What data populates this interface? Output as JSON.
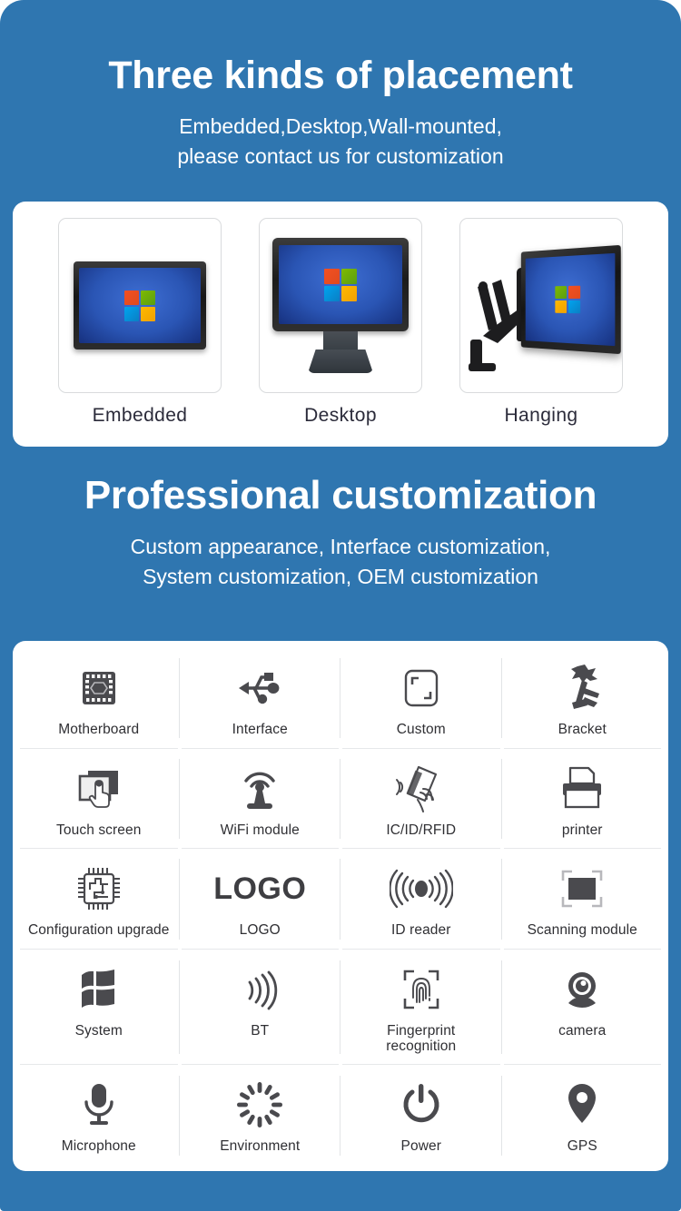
{
  "theme": {
    "brand_blue": "#2f76b0",
    "card_white": "#ffffff",
    "icon_gray": "#4a4a4e",
    "label_text": "#2f2f33",
    "divider": "#e2e4e6"
  },
  "sections": {
    "placement": {
      "title": "Three kinds of placement",
      "subtitle_line1": "Embedded,Desktop,Wall-mounted,",
      "subtitle_line2": "please contact us for customization",
      "items": [
        {
          "label": "Embedded",
          "icon": "embedded-monitor-icon"
        },
        {
          "label": "Desktop",
          "icon": "desktop-monitor-icon"
        },
        {
          "label": "Hanging",
          "icon": "wall-mount-monitor-icon"
        }
      ]
    },
    "customization": {
      "title": "Professional customization",
      "subtitle_line1": "Custom appearance, Interface customization,",
      "subtitle_line2": "System customization, OEM customization",
      "features": [
        {
          "label": "Motherboard",
          "icon": "chip-icon"
        },
        {
          "label": "Interface",
          "icon": "usb-icon"
        },
        {
          "label": "Custom",
          "icon": "rounded-square-crop-icon"
        },
        {
          "label": "Bracket",
          "icon": "bracket-mount-icon"
        },
        {
          "label": "Touch screen",
          "icon": "touch-screen-icon"
        },
        {
          "label": "WiFi module",
          "icon": "wifi-antenna-icon"
        },
        {
          "label": "IC/ID/RFID",
          "icon": "rfid-card-hand-icon"
        },
        {
          "label": "printer",
          "icon": "printer-icon"
        },
        {
          "label": "Configuration upgrade",
          "icon": "cpu-circuit-icon"
        },
        {
          "label": "LOGO",
          "icon": "logo-text-icon"
        },
        {
          "label": "ID reader",
          "icon": "id-reader-waves-icon"
        },
        {
          "label": "Scanning module",
          "icon": "scanner-frame-icon"
        },
        {
          "label": "System",
          "icon": "windows-flag-icon"
        },
        {
          "label": "BT",
          "icon": "bluetooth-waves-icon"
        },
        {
          "label": "Fingerprint\nrecognition",
          "icon": "fingerprint-icon"
        },
        {
          "label": "camera",
          "icon": "webcam-icon"
        },
        {
          "label": "Microphone",
          "icon": "microphone-icon"
        },
        {
          "label": "Environment",
          "icon": "spinner-rays-icon"
        },
        {
          "label": "Power",
          "icon": "power-icon"
        },
        {
          "label": "GPS",
          "icon": "map-pin-icon"
        }
      ]
    }
  }
}
